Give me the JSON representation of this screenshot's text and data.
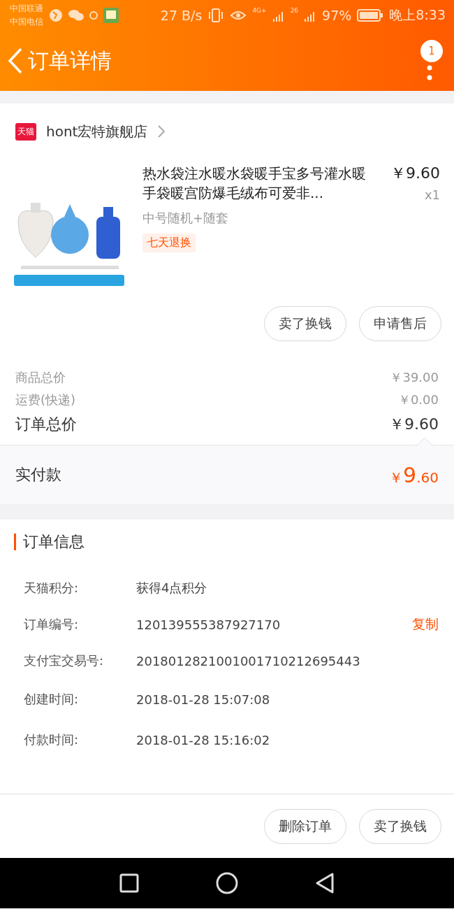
{
  "status_bar": {
    "carriers": [
      "中国联通",
      "中国电信"
    ],
    "speed": "27 B/s",
    "network_a": "4G+",
    "network_b": "26",
    "battery": "97%",
    "time": "晚上8:33"
  },
  "header": {
    "title": "订单详情",
    "badge": "1"
  },
  "store": {
    "badge": "天猫",
    "name": "hont宏特旗舰店"
  },
  "product": {
    "title": "热水袋注水暖水袋暖手宝多号灌水暖手袋暖宫防爆毛绒布可爱非...",
    "price": "￥9.60",
    "quantity": "x1",
    "variant": "中号随机+随套",
    "tag": "七天退换"
  },
  "item_buttons": [
    "卖了换钱",
    "申请售后"
  ],
  "summary": [
    {
      "label": "商品总价",
      "value": "￥39.00",
      "kind": "minor"
    },
    {
      "label": "运费(快递)",
      "value": "￥0.00",
      "kind": "minor"
    },
    {
      "label": "订单总价",
      "value": "￥9.60",
      "kind": "major"
    }
  ],
  "paid": {
    "label": "实付款",
    "currency": "￥",
    "integer": "9",
    "decimal": ".60"
  },
  "order_info": {
    "title": "订单信息",
    "rows": [
      {
        "label": "天猫积分:",
        "value": "获得4点积分"
      },
      {
        "label": "订单编号:",
        "value": "120139555387927170",
        "action": "复制"
      },
      {
        "label": "支付宝交易号:",
        "value": "2018012821001001710212695443"
      },
      {
        "label": "创建时间:",
        "value": "2018-01-28 15:07:08"
      },
      {
        "label": "付款时间:",
        "value": "2018-01-28 15:16:02"
      }
    ]
  },
  "bottom_buttons": [
    "删除订单",
    "卖了换钱"
  ]
}
